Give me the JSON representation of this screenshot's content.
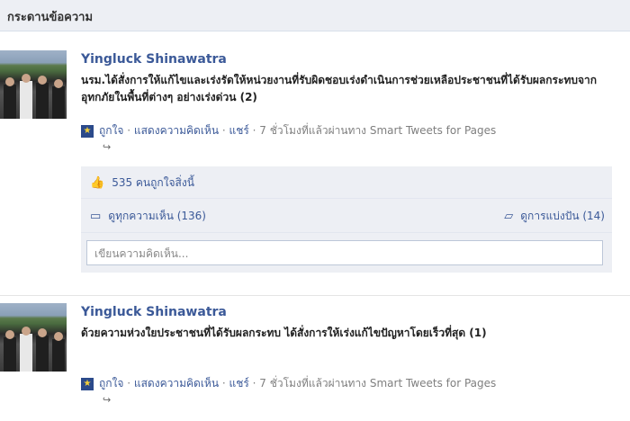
{
  "header": {
    "title": "กระดานข้อความ"
  },
  "posts": [
    {
      "author": "Yingluck Shinawatra",
      "message": "นรม.ได้สั่งการให้แก้ไขและเร่งรัดให้หน่วยงานที่รับผิดชอบเร่งดำเนินการช่วยเหลือประชาชนที่ได้รับผลกระทบจากอุทกภัยในพื้นที่ต่างๆ อย่างเร่งด่วน (2)",
      "meta": {
        "like": "ถูกใจ",
        "comment": "แสดงความคิดเห็น",
        "share": "แชร์",
        "time": "7 ชั่วโมงที่แล้วผ่านทาง Smart Tweets for Pages"
      },
      "likes_text": "535 คนถูกใจสิ่งนี้",
      "view_comments": "ดูทุกความเห็น (136)",
      "shares_text": "ดูการแบ่งปัน (14)",
      "comment_placeholder": "เขียนความคิดเห็น..."
    },
    {
      "author": "Yingluck Shinawatra",
      "message": "ด้วยความห่วงใยประชาชนที่ได้รับผลกระทบ ได้สั่งการให้เร่งแก้ไขปัญหาโดยเร็วที่สุด (1)",
      "meta": {
        "like": "ถูกใจ",
        "comment": "แสดงความคิดเห็น",
        "share": "แชร์",
        "time": "7 ชั่วโมงที่แล้วผ่านทาง Smart Tweets for Pages"
      }
    }
  ],
  "colors": {
    "link": "#3b5998",
    "ufi_bg": "#edeff4",
    "header_bg": "#edeff4"
  },
  "icons": {
    "like": "thumbs-up-icon",
    "comment": "comment-icon",
    "share": "share-icon",
    "app": "app-icon"
  }
}
